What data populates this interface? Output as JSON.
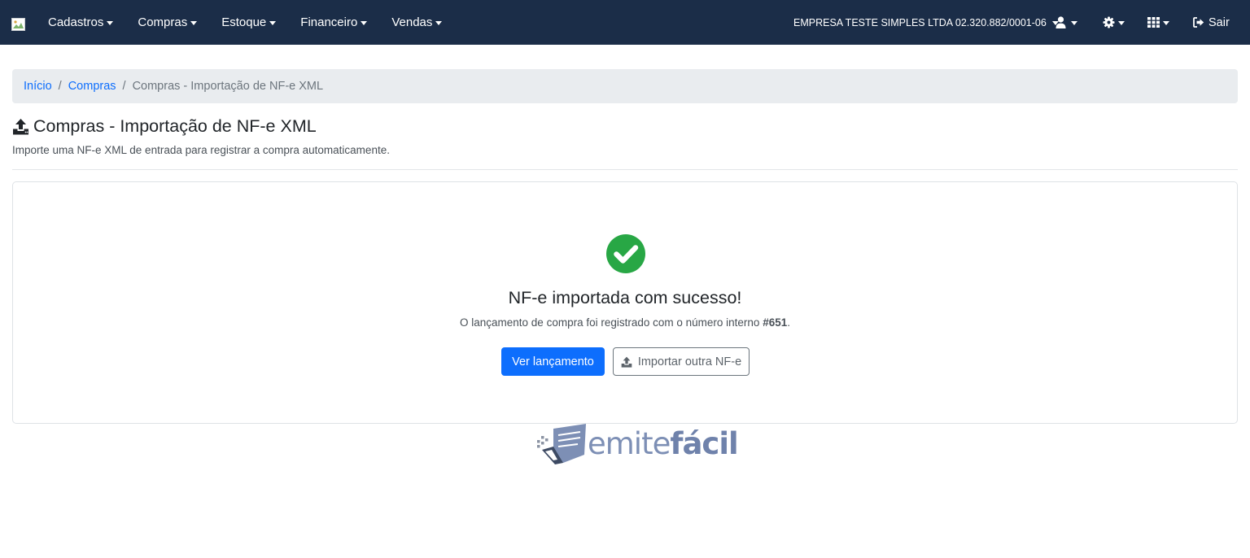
{
  "navbar": {
    "menus": [
      {
        "label": "Cadastros"
      },
      {
        "label": "Compras"
      },
      {
        "label": "Estoque"
      },
      {
        "label": "Financeiro"
      },
      {
        "label": "Vendas"
      }
    ],
    "company": "EMPRESA TESTE SIMPLES LTDA 02.320.882/0001-06",
    "user_icon": "user-icon",
    "settings_icon": "gear-icon",
    "apps_icon": "grid-icon",
    "logout_label": "Sair",
    "logout_icon": "sign-out-icon",
    "background_color": "#1b2d48"
  },
  "breadcrumb": {
    "home": "Início",
    "parent": "Compras",
    "current": "Compras - Importação de NF-e XML"
  },
  "page": {
    "title": "Compras - Importação de NF-e XML",
    "title_icon": "upload-icon",
    "subtitle": "Importe uma NF-e XML de entrada para registrar a compra automaticamente."
  },
  "result": {
    "icon": "check-circle-icon",
    "icon_color": "#28a745",
    "title": "NF-e importada com sucesso!",
    "message_prefix": "O lançamento de compra foi registrado com o número interno ",
    "internal_number": "#651",
    "message_suffix": ".",
    "primary_button": "Ver lançamento",
    "secondary_button": "Importar outra NF-e",
    "primary_color": "#0d6efd"
  },
  "footer": {
    "logo_text_plain": "emite",
    "logo_text_accent": "fácil"
  }
}
